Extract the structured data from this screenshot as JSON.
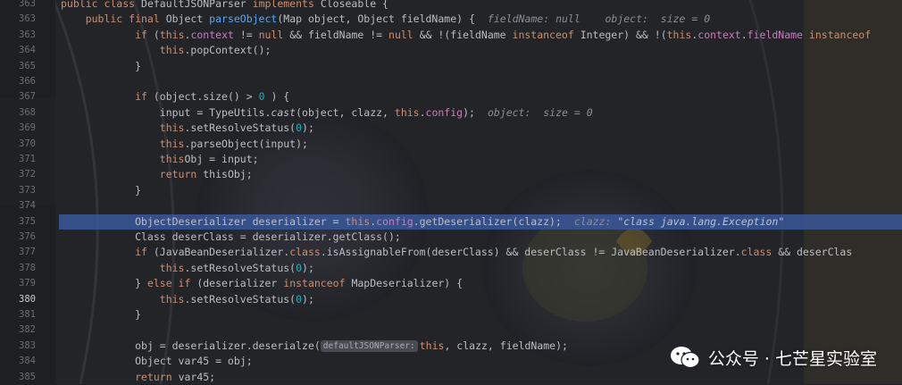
{
  "editor": {
    "lines": [
      {
        "n": "363",
        "segs": [
          [
            "kw",
            "public class "
          ],
          [
            "",
            "DefaultJSONParser "
          ],
          [
            "kw",
            "implements "
          ],
          [
            "",
            "Closeable { "
          ]
        ]
      },
      {
        "n": "363",
        "segs": [
          [
            "kw",
            "    public final "
          ],
          [
            "",
            "Object "
          ],
          [
            "fn",
            "parseObject"
          ],
          [
            "",
            "(Map object, Object fieldName) {"
          ],
          [
            "hint",
            "fieldName: null    object:  size = 0"
          ]
        ]
      },
      {
        "n": "363",
        "segs": [
          [
            "",
            "            "
          ],
          [
            "kw",
            "if "
          ],
          [
            "",
            "("
          ],
          [
            "kw",
            "this"
          ],
          [
            "",
            "."
          ],
          [
            "fld",
            "context"
          ],
          [
            "",
            " != "
          ],
          [
            "kw",
            "null"
          ],
          [
            "",
            " && fieldName != "
          ],
          [
            "kw",
            "null"
          ],
          [
            "",
            " && !(fieldName "
          ],
          [
            "kw",
            "instanceof "
          ],
          [
            "",
            "Integer) && !("
          ],
          [
            "kw",
            "this"
          ],
          [
            "",
            "."
          ],
          [
            "fld",
            "context"
          ],
          [
            "",
            "."
          ],
          [
            "fld",
            "fieldName"
          ],
          [
            "",
            " "
          ],
          [
            "kw",
            "instanceof"
          ]
        ]
      },
      {
        "n": "364",
        "segs": [
          [
            "",
            "                "
          ],
          [
            "kw",
            "this"
          ],
          [
            "",
            ".popContext();"
          ]
        ]
      },
      {
        "n": "365",
        "segs": [
          [
            "",
            "            }"
          ]
        ]
      },
      {
        "n": "366",
        "segs": []
      },
      {
        "n": "367",
        "segs": [
          [
            "",
            "            "
          ],
          [
            "kw",
            "if "
          ],
          [
            "",
            "(object.size() > "
          ],
          [
            "num",
            "0"
          ],
          [
            "",
            " ) {"
          ]
        ]
      },
      {
        "n": "368",
        "segs": [
          [
            "",
            "                input = TypeUtils."
          ],
          [
            "ital",
            "cast"
          ],
          [
            "",
            "(object, clazz, "
          ],
          [
            "kw",
            "this"
          ],
          [
            "",
            "."
          ],
          [
            "fld",
            "config"
          ],
          [
            "",
            ");"
          ],
          [
            "hint",
            "object:  size = 0"
          ]
        ]
      },
      {
        "n": "369",
        "segs": [
          [
            "",
            "                "
          ],
          [
            "kw",
            "this"
          ],
          [
            "",
            ".setResolveStatus("
          ],
          [
            "num",
            "0"
          ],
          [
            "",
            ");"
          ]
        ]
      },
      {
        "n": "370",
        "segs": [
          [
            "",
            "                "
          ],
          [
            "kw",
            "this"
          ],
          [
            "",
            ".parseObject(input);"
          ]
        ]
      },
      {
        "n": "371",
        "segs": [
          [
            "",
            "                "
          ],
          [
            "kw",
            "this"
          ],
          [
            "",
            "Obj = input;"
          ]
        ]
      },
      {
        "n": "372",
        "segs": [
          [
            "",
            "                "
          ],
          [
            "kw",
            "return "
          ],
          [
            "",
            "thisObj;"
          ]
        ]
      },
      {
        "n": "373",
        "segs": [
          [
            "",
            "            }"
          ]
        ]
      },
      {
        "n": "374",
        "segs": []
      },
      {
        "n": "375",
        "hl": true,
        "segs": [
          [
            "",
            "            ObjectDeserializer deserializer = "
          ],
          [
            "kw",
            "this"
          ],
          [
            "",
            "."
          ],
          [
            "fld",
            "config"
          ],
          [
            "",
            ".getDeserializer(clazz);"
          ],
          [
            "hint",
            "clazz: "
          ],
          [
            "hintstr",
            "\"class java.lang.Exception\""
          ]
        ]
      },
      {
        "n": "376",
        "segs": [
          [
            "",
            "            Class deserClass = deserializer.getClass();"
          ]
        ]
      },
      {
        "n": "377",
        "segs": [
          [
            "",
            "            "
          ],
          [
            "kw",
            "if "
          ],
          [
            "",
            "(JavaBeanDeserializer."
          ],
          [
            "kw",
            "class"
          ],
          [
            "",
            ".isAssignableFrom(deserClass) && deserClass != JavaBeanDeserializer."
          ],
          [
            "kw",
            "class"
          ],
          [
            "",
            " && deserClas"
          ]
        ]
      },
      {
        "n": "378",
        "segs": [
          [
            "",
            "                "
          ],
          [
            "kw",
            "this"
          ],
          [
            "",
            ".setResolveStatus("
          ],
          [
            "num",
            "0"
          ],
          [
            "",
            ");"
          ]
        ]
      },
      {
        "n": "379",
        "segs": [
          [
            "",
            "            } "
          ],
          [
            "kw",
            "else if "
          ],
          [
            "",
            "(deserializer "
          ],
          [
            "kw",
            "instanceof "
          ],
          [
            "",
            "MapDeserializer) {"
          ]
        ]
      },
      {
        "n": "380",
        "cur": true,
        "segs": [
          [
            "",
            "                "
          ],
          [
            "kw",
            "this"
          ],
          [
            "",
            ".setResolveStatus("
          ],
          [
            "num",
            "0"
          ],
          [
            "",
            ");"
          ]
        ]
      },
      {
        "n": "381",
        "segs": [
          [
            "",
            "            }"
          ]
        ]
      },
      {
        "n": "382",
        "segs": []
      },
      {
        "n": "383",
        "segs": [
          [
            "",
            "            obj = deserializer.deserialze("
          ],
          [
            "inlay",
            "defaultJSONParser:"
          ],
          [
            "kw",
            "this"
          ],
          [
            "",
            ", clazz, fieldName);"
          ]
        ]
      },
      {
        "n": "384",
        "segs": [
          [
            "",
            "            Object var45 = obj;"
          ]
        ]
      },
      {
        "n": "385",
        "segs": [
          [
            "",
            "            "
          ],
          [
            "kw",
            "return "
          ],
          [
            "",
            "var45;"
          ]
        ]
      }
    ]
  },
  "watermark": {
    "text": "公众号 · 七芒星实验室"
  },
  "colors": {
    "background": "#1f2024",
    "highlight": "#3a5aa0",
    "keyword": "#cf8e6d",
    "field": "#c77dbb"
  }
}
